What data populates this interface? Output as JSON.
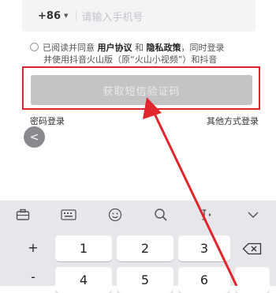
{
  "phone": {
    "country_code": "+86",
    "placeholder": "请输入手机号"
  },
  "consent": {
    "prefix": "已阅读并同意",
    "user_agreement": "用户协议",
    "and": "和",
    "privacy_policy": "隐私政策",
    "suffix": "，同时登录",
    "line2": "并使用抖音火山版（原“火山小视频”）和抖音"
  },
  "buttons": {
    "get_code": "获取短信验证码",
    "password_login": "密码登录",
    "other_login": "其他方式登录",
    "back": "<"
  },
  "keyboard": {
    "toolbar_icons": [
      "briefcase-icon",
      "keyboard-icon",
      "emoji-icon",
      "search-icon",
      "cursor-icon",
      "collapse-icon"
    ],
    "keys": {
      "plus": "+",
      "minus": "-",
      "k1": "1",
      "k2": "2",
      "k3": "3",
      "k4": "4",
      "k5": "5",
      "k6": "6"
    }
  },
  "colors": {
    "highlight": "#e0262c",
    "arrow": "#e0262c",
    "button_disabled": "#c4c4c6"
  }
}
